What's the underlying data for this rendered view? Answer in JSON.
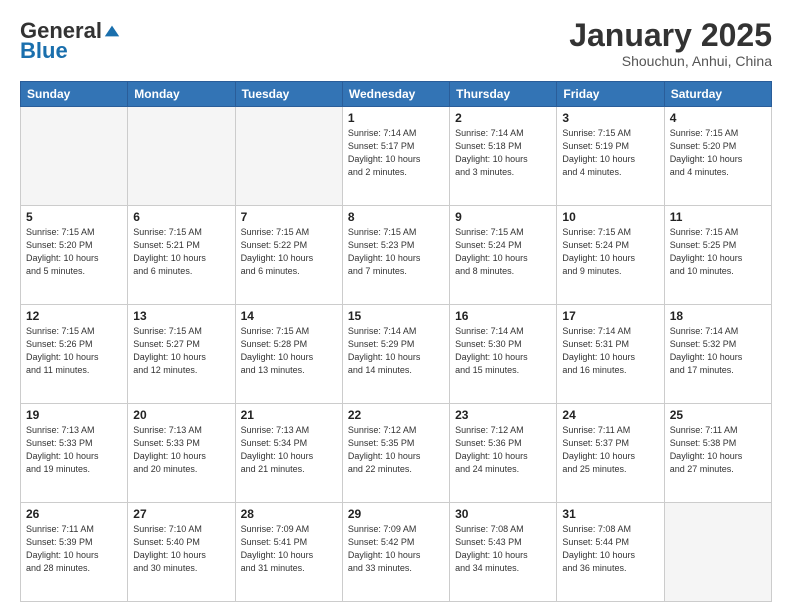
{
  "header": {
    "logo": {
      "general": "General",
      "blue": "Blue"
    },
    "title": "January 2025",
    "location": "Shouchun, Anhui, China"
  },
  "weekdays": [
    "Sunday",
    "Monday",
    "Tuesday",
    "Wednesday",
    "Thursday",
    "Friday",
    "Saturday"
  ],
  "weeks": [
    [
      {
        "day": "",
        "info": ""
      },
      {
        "day": "",
        "info": ""
      },
      {
        "day": "",
        "info": ""
      },
      {
        "day": "1",
        "info": "Sunrise: 7:14 AM\nSunset: 5:17 PM\nDaylight: 10 hours\nand 2 minutes."
      },
      {
        "day": "2",
        "info": "Sunrise: 7:14 AM\nSunset: 5:18 PM\nDaylight: 10 hours\nand 3 minutes."
      },
      {
        "day": "3",
        "info": "Sunrise: 7:15 AM\nSunset: 5:19 PM\nDaylight: 10 hours\nand 4 minutes."
      },
      {
        "day": "4",
        "info": "Sunrise: 7:15 AM\nSunset: 5:20 PM\nDaylight: 10 hours\nand 4 minutes."
      }
    ],
    [
      {
        "day": "5",
        "info": "Sunrise: 7:15 AM\nSunset: 5:20 PM\nDaylight: 10 hours\nand 5 minutes."
      },
      {
        "day": "6",
        "info": "Sunrise: 7:15 AM\nSunset: 5:21 PM\nDaylight: 10 hours\nand 6 minutes."
      },
      {
        "day": "7",
        "info": "Sunrise: 7:15 AM\nSunset: 5:22 PM\nDaylight: 10 hours\nand 6 minutes."
      },
      {
        "day": "8",
        "info": "Sunrise: 7:15 AM\nSunset: 5:23 PM\nDaylight: 10 hours\nand 7 minutes."
      },
      {
        "day": "9",
        "info": "Sunrise: 7:15 AM\nSunset: 5:24 PM\nDaylight: 10 hours\nand 8 minutes."
      },
      {
        "day": "10",
        "info": "Sunrise: 7:15 AM\nSunset: 5:24 PM\nDaylight: 10 hours\nand 9 minutes."
      },
      {
        "day": "11",
        "info": "Sunrise: 7:15 AM\nSunset: 5:25 PM\nDaylight: 10 hours\nand 10 minutes."
      }
    ],
    [
      {
        "day": "12",
        "info": "Sunrise: 7:15 AM\nSunset: 5:26 PM\nDaylight: 10 hours\nand 11 minutes."
      },
      {
        "day": "13",
        "info": "Sunrise: 7:15 AM\nSunset: 5:27 PM\nDaylight: 10 hours\nand 12 minutes."
      },
      {
        "day": "14",
        "info": "Sunrise: 7:15 AM\nSunset: 5:28 PM\nDaylight: 10 hours\nand 13 minutes."
      },
      {
        "day": "15",
        "info": "Sunrise: 7:14 AM\nSunset: 5:29 PM\nDaylight: 10 hours\nand 14 minutes."
      },
      {
        "day": "16",
        "info": "Sunrise: 7:14 AM\nSunset: 5:30 PM\nDaylight: 10 hours\nand 15 minutes."
      },
      {
        "day": "17",
        "info": "Sunrise: 7:14 AM\nSunset: 5:31 PM\nDaylight: 10 hours\nand 16 minutes."
      },
      {
        "day": "18",
        "info": "Sunrise: 7:14 AM\nSunset: 5:32 PM\nDaylight: 10 hours\nand 17 minutes."
      }
    ],
    [
      {
        "day": "19",
        "info": "Sunrise: 7:13 AM\nSunset: 5:33 PM\nDaylight: 10 hours\nand 19 minutes."
      },
      {
        "day": "20",
        "info": "Sunrise: 7:13 AM\nSunset: 5:33 PM\nDaylight: 10 hours\nand 20 minutes."
      },
      {
        "day": "21",
        "info": "Sunrise: 7:13 AM\nSunset: 5:34 PM\nDaylight: 10 hours\nand 21 minutes."
      },
      {
        "day": "22",
        "info": "Sunrise: 7:12 AM\nSunset: 5:35 PM\nDaylight: 10 hours\nand 22 minutes."
      },
      {
        "day": "23",
        "info": "Sunrise: 7:12 AM\nSunset: 5:36 PM\nDaylight: 10 hours\nand 24 minutes."
      },
      {
        "day": "24",
        "info": "Sunrise: 7:11 AM\nSunset: 5:37 PM\nDaylight: 10 hours\nand 25 minutes."
      },
      {
        "day": "25",
        "info": "Sunrise: 7:11 AM\nSunset: 5:38 PM\nDaylight: 10 hours\nand 27 minutes."
      }
    ],
    [
      {
        "day": "26",
        "info": "Sunrise: 7:11 AM\nSunset: 5:39 PM\nDaylight: 10 hours\nand 28 minutes."
      },
      {
        "day": "27",
        "info": "Sunrise: 7:10 AM\nSunset: 5:40 PM\nDaylight: 10 hours\nand 30 minutes."
      },
      {
        "day": "28",
        "info": "Sunrise: 7:09 AM\nSunset: 5:41 PM\nDaylight: 10 hours\nand 31 minutes."
      },
      {
        "day": "29",
        "info": "Sunrise: 7:09 AM\nSunset: 5:42 PM\nDaylight: 10 hours\nand 33 minutes."
      },
      {
        "day": "30",
        "info": "Sunrise: 7:08 AM\nSunset: 5:43 PM\nDaylight: 10 hours\nand 34 minutes."
      },
      {
        "day": "31",
        "info": "Sunrise: 7:08 AM\nSunset: 5:44 PM\nDaylight: 10 hours\nand 36 minutes."
      },
      {
        "day": "",
        "info": ""
      }
    ]
  ]
}
